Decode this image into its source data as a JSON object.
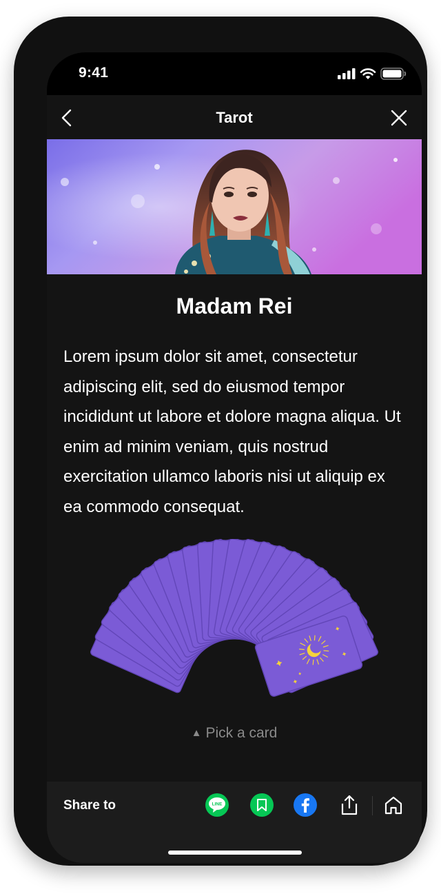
{
  "status_bar": {
    "time": "9:41"
  },
  "nav": {
    "title": "Tarot",
    "back_icon": "chevron-left-icon",
    "close_icon": "close-icon"
  },
  "reader": {
    "name": "Madam Rei",
    "description": "Lorem ipsum dolor sit amet, consectetur adipiscing elit, sed do eiusmod tempor incididunt ut labore et dolore magna aliqua. Ut enim ad minim veniam, quis nostrud exercitation ullamco laboris nisi ut aliquip ex ea commodo consequat."
  },
  "deck": {
    "prompt": "Pick a card",
    "prompt_icon": "triangle-up-icon",
    "card_color": "#7b5bd6",
    "sun_color": "#f4d23c"
  },
  "share": {
    "label": "Share to",
    "line_label": "LINE",
    "icons": [
      "line-icon",
      "bookmark-icon",
      "facebook-icon",
      "share-icon",
      "home-icon"
    ],
    "colors": {
      "line": "#06c755",
      "bookmark": "#06c755",
      "facebook": "#1877f2"
    }
  }
}
